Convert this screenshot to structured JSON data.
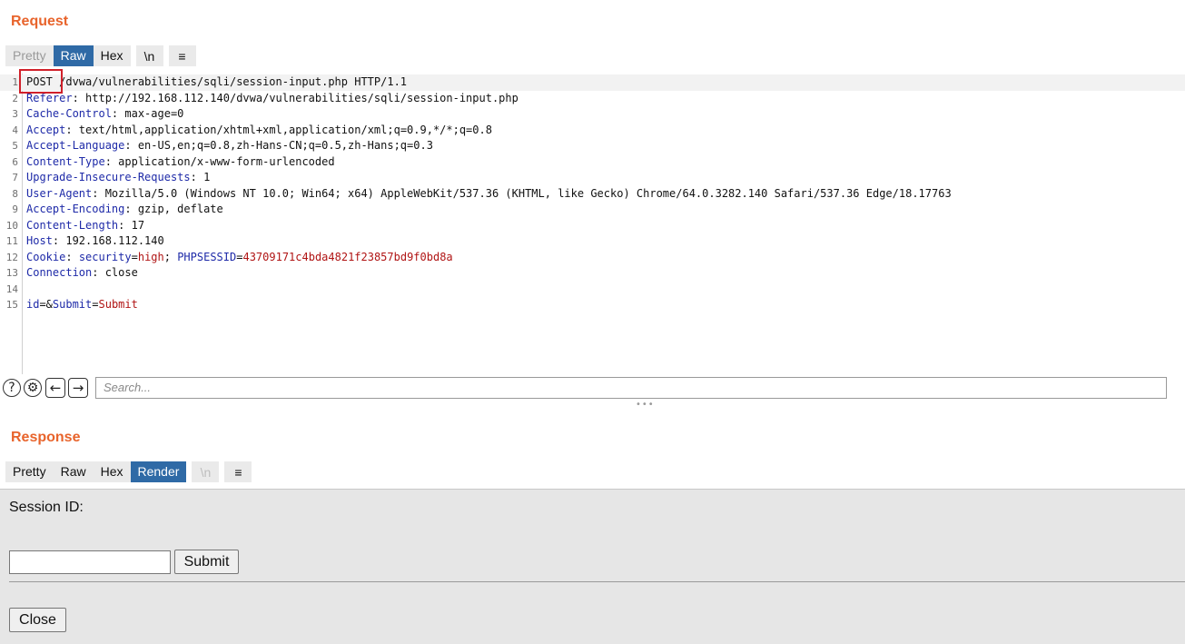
{
  "request": {
    "title": "Request",
    "tabs": [
      "Pretty",
      "Raw",
      "Hex"
    ],
    "newline_label": "\\n",
    "menu_icon": "≡",
    "lines": [
      {
        "n": "1",
        "parts": [
          {
            "t": "POST /dvwa/vulnerabilities/sqli/session-input.php HTTP/1.1",
            "c": ""
          }
        ]
      },
      {
        "n": "2",
        "parts": [
          {
            "t": "Referer",
            "c": "hname"
          },
          {
            "t": ": http://192.168.112.140/dvwa/vulnerabilities/sqli/session-input.php",
            "c": ""
          }
        ]
      },
      {
        "n": "3",
        "parts": [
          {
            "t": "Cache-Control",
            "c": "hname"
          },
          {
            "t": ": max-age=0",
            "c": ""
          }
        ]
      },
      {
        "n": "4",
        "parts": [
          {
            "t": "Accept",
            "c": "hname"
          },
          {
            "t": ": text/html,application/xhtml+xml,application/xml;q=0.9,*/*;q=0.8",
            "c": ""
          }
        ]
      },
      {
        "n": "5",
        "parts": [
          {
            "t": "Accept-Language",
            "c": "hname"
          },
          {
            "t": ": en-US,en;q=0.8,zh-Hans-CN;q=0.5,zh-Hans;q=0.3",
            "c": ""
          }
        ]
      },
      {
        "n": "6",
        "parts": [
          {
            "t": "Content-Type",
            "c": "hname"
          },
          {
            "t": ": application/x-www-form-urlencoded",
            "c": ""
          }
        ]
      },
      {
        "n": "7",
        "parts": [
          {
            "t": "Upgrade-Insecure-Requests",
            "c": "hname"
          },
          {
            "t": ": 1",
            "c": ""
          }
        ]
      },
      {
        "n": "8",
        "parts": [
          {
            "t": "User-Agent",
            "c": "hname"
          },
          {
            "t": ": Mozilla/5.0 (Windows NT 10.0; Win64; x64) AppleWebKit/537.36 (KHTML, like Gecko) Chrome/64.0.3282.140 Safari/537.36 Edge/18.17763",
            "c": ""
          }
        ]
      },
      {
        "n": "9",
        "parts": [
          {
            "t": "Accept-Encoding",
            "c": "hname"
          },
          {
            "t": ": gzip, deflate",
            "c": ""
          }
        ]
      },
      {
        "n": "10",
        "parts": [
          {
            "t": "Content-Length",
            "c": "hname"
          },
          {
            "t": ": 17",
            "c": ""
          }
        ]
      },
      {
        "n": "11",
        "parts": [
          {
            "t": "Host",
            "c": "hname"
          },
          {
            "t": ": 192.168.112.140",
            "c": ""
          }
        ]
      },
      {
        "n": "12",
        "parts": [
          {
            "t": "Cookie",
            "c": "hname"
          },
          {
            "t": ": ",
            "c": ""
          },
          {
            "t": "security",
            "c": "blue"
          },
          {
            "t": "=",
            "c": ""
          },
          {
            "t": "high",
            "c": "red"
          },
          {
            "t": "; ",
            "c": ""
          },
          {
            "t": "PHPSESSID",
            "c": "blue"
          },
          {
            "t": "=",
            "c": ""
          },
          {
            "t": "43709171c4bda4821f23857bd9f0bd8a",
            "c": "red"
          }
        ]
      },
      {
        "n": "13",
        "parts": [
          {
            "t": "Connection",
            "c": "hname"
          },
          {
            "t": ": close",
            "c": ""
          }
        ]
      },
      {
        "n": "14",
        "parts": []
      },
      {
        "n": "15",
        "parts": [
          {
            "t": "id",
            "c": "blue"
          },
          {
            "t": "=&",
            "c": ""
          },
          {
            "t": "Submit",
            "c": "blue"
          },
          {
            "t": "=",
            "c": ""
          },
          {
            "t": "Submit",
            "c": "red"
          }
        ]
      }
    ],
    "search_placeholder": "Search..."
  },
  "response": {
    "title": "Response",
    "tabs": [
      "Pretty",
      "Raw",
      "Hex",
      "Render"
    ],
    "newline_label": "\\n",
    "menu_icon": "≡",
    "render": {
      "label": "Session ID:",
      "submit_label": "Submit",
      "close_label": "Close"
    }
  }
}
